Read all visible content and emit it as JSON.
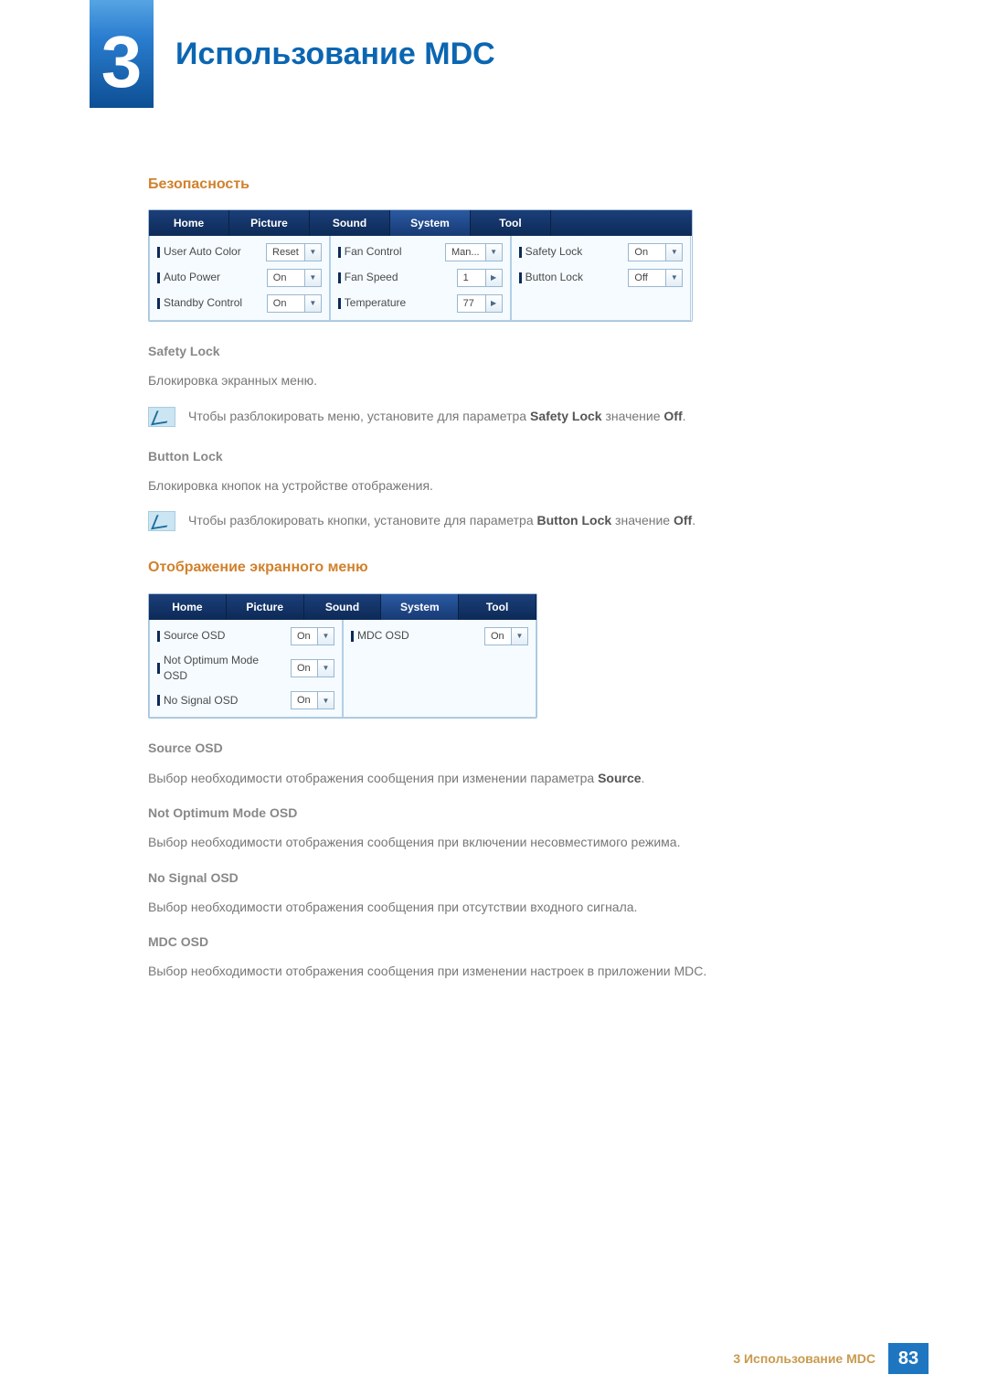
{
  "chapter": {
    "number": "3",
    "title": "Использование MDC"
  },
  "footer": {
    "text": "3 Использование MDC",
    "page": "83"
  },
  "section_security": {
    "heading": "Безопасность",
    "tabs": [
      "Home",
      "Picture",
      "Sound",
      "System",
      "Tool"
    ],
    "col1": [
      {
        "label": "User Auto Color",
        "value": "Reset",
        "kind": "dd"
      },
      {
        "label": "Auto Power",
        "value": "On",
        "kind": "dd"
      },
      {
        "label": "Standby Control",
        "value": "On",
        "kind": "dd"
      }
    ],
    "col2": [
      {
        "label": "Fan Control",
        "value": "Man...",
        "kind": "dd"
      },
      {
        "label": "Fan Speed",
        "value": "1",
        "kind": "spin"
      },
      {
        "label": "Temperature",
        "value": "77",
        "kind": "spin"
      }
    ],
    "col3": [
      {
        "label": "Safety Lock",
        "value": "On",
        "kind": "dd"
      },
      {
        "label": "Button Lock",
        "value": "Off",
        "kind": "dd"
      }
    ],
    "sl_head": "Safety Lock",
    "sl_body": "Блокировка экранных меню.",
    "sl_note_a": "Чтобы разблокировать меню, установите для параметра ",
    "sl_note_b": "Safety Lock",
    "sl_note_c": " значение ",
    "sl_note_d": "Off",
    "sl_note_e": ".",
    "bl_head": "Button Lock",
    "bl_body": "Блокировка кнопок на устройстве отображения.",
    "bl_note_a": "Чтобы разблокировать кнопки, установите для параметра ",
    "bl_note_b": "Button Lock",
    "bl_note_c": " значение ",
    "bl_note_d": "Off",
    "bl_note_e": "."
  },
  "section_osd": {
    "heading": "Отображение экранного меню",
    "tabs": [
      "Home",
      "Picture",
      "Sound",
      "System",
      "Tool"
    ],
    "colL": [
      {
        "label": "Source OSD",
        "value": "On",
        "kind": "dd"
      },
      {
        "label": "Not Optimum Mode OSD",
        "value": "On",
        "kind": "dd"
      },
      {
        "label": "No Signal OSD",
        "value": "On",
        "kind": "dd"
      }
    ],
    "colR": [
      {
        "label": "MDC OSD",
        "value": "On",
        "kind": "dd"
      }
    ],
    "src_head": "Source OSD",
    "src_body_a": "Выбор необходимости отображения сообщения при изменении параметра ",
    "src_body_b": "Source",
    "src_body_c": ".",
    "nom_head": "Not Optimum Mode OSD",
    "nom_body": "Выбор необходимости отображения сообщения при включении несовместимого режима.",
    "nos_head": "No Signal OSD",
    "nos_body": "Выбор необходимости отображения сообщения при отсутствии входного сигнала.",
    "mdc_head": "MDC OSD",
    "mdc_body": "Выбор необходимости отображения сообщения при изменении настроек в приложении MDC."
  }
}
